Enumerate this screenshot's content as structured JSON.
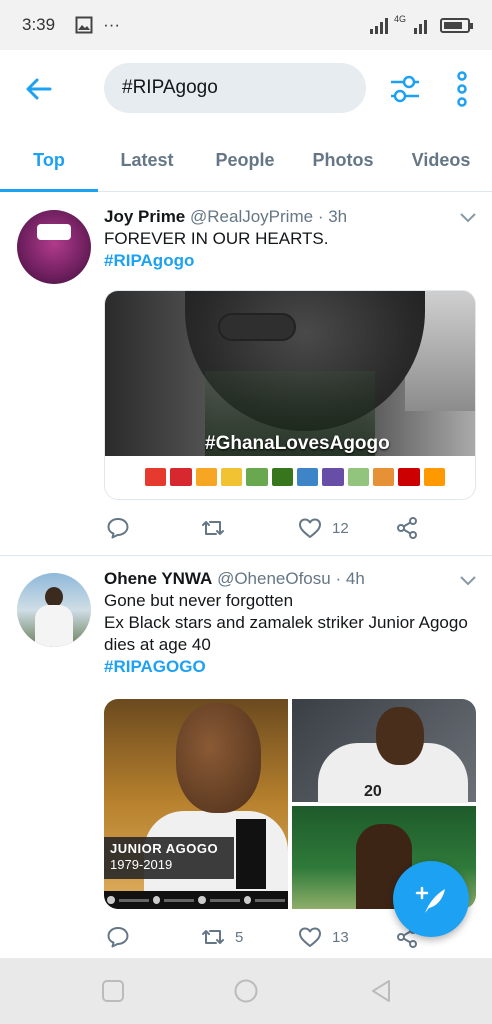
{
  "status_bar": {
    "time": "3:39",
    "more": "···",
    "network": "4G",
    "icons": [
      "gallery-icon",
      "signal-icon",
      "signal-icon",
      "battery-icon"
    ],
    "battery_level": 0.7
  },
  "search": {
    "query": "#RIPAgogo"
  },
  "tabs": [
    {
      "label": "Top",
      "active": true
    },
    {
      "label": "Latest",
      "active": false
    },
    {
      "label": "People",
      "active": false
    },
    {
      "label": "Photos",
      "active": false
    },
    {
      "label": "Videos",
      "active": false
    }
  ],
  "tweets": [
    {
      "name": "Joy Prime",
      "handle": "@RealJoyPrime",
      "dot": "·",
      "age": "3h",
      "lines": [
        "FOREVER IN OUR HEARTS."
      ],
      "hashtag": "#RIPAgogo",
      "media_overlay": "#GhanaLovesAgogo",
      "retweets": "",
      "likes": "12"
    },
    {
      "name": "Ohene YNWA",
      "handle": "@OheneOfosu",
      "dot": "·",
      "age": "4h",
      "lines": [
        "Gone but never forgotten",
        "Ex Black stars and zamalek striker Junior Agogo",
        "dies at age 40"
      ],
      "hashtag": "#RIPAGOGO",
      "media_name": "JUNIOR AGOGO",
      "media_years": "1979-2019",
      "media_jersey": "20",
      "retweets": "5",
      "likes": "13"
    }
  ],
  "colors": {
    "accent": "#1da1f2",
    "muted": "#657786",
    "text": "#14171a"
  }
}
